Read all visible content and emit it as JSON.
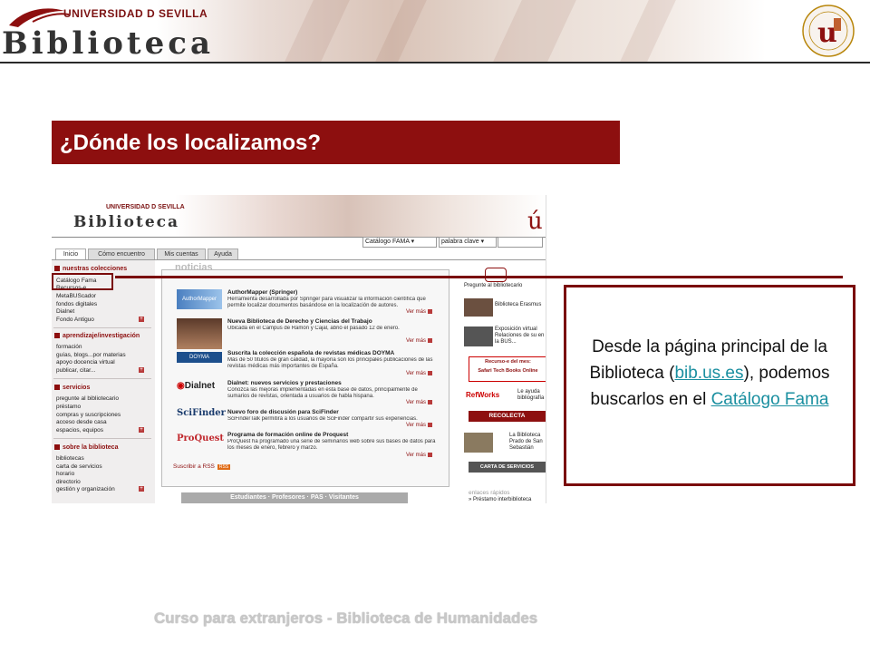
{
  "header": {
    "logo_title": "Biblioteca",
    "logo_university": "UNIVERSIDAD D SEVILLA"
  },
  "slide": {
    "title": "¿Dónde los localizamos?",
    "callout": {
      "text_1": "Desde la página principal de la Biblioteca (",
      "link_1": "bib.us.es",
      "text_2": "), podemos buscarlos en el ",
      "link_2": "Catálogo Fama"
    },
    "footer": "Curso para extranjeros - Biblioteca de Humanidades"
  },
  "screenshot": {
    "logo_title": "Biblioteca",
    "logo_university": "UNIVERSIDAD D SEVILLA",
    "search": {
      "catalog": "Catálogo FAMA",
      "field": "palabra clave"
    },
    "tabs": [
      "Inicio",
      "Cómo encuentro",
      "Mis cuentas",
      "Ayuda"
    ],
    "menu": {
      "collections_title": "nuestras colecciones",
      "collections": [
        "Catálogo Fama",
        "Recursos-e",
        "MetaBUScador",
        "fondos digitales",
        "Dialnet",
        "Fondo Antiguo"
      ],
      "learning_title": "aprendizaje/investigación",
      "learning": [
        "formación",
        "guías, blogs...por materias",
        "apoyo docencia virtual",
        "publicar, citar..."
      ],
      "services_title": "servicios",
      "services": [
        "pregunte al bibliotecario",
        "préstamo",
        "compras y suscripciones",
        "acceso desde casa",
        "espacios, equipos"
      ],
      "about_title": "sobre la biblioteca",
      "about": [
        "bibliotecas",
        "carta de servicios",
        "horario",
        "directorio",
        "gestión y organización"
      ]
    },
    "news_title": "noticias",
    "news": [
      {
        "title": "AuthorMapper (Springer)",
        "text": "Herramienta desarrollada por Springer para visualizar la información científica que permite localizar documentos basándose en la localización de autores."
      },
      {
        "title": "Nueva Biblioteca de Derecho y Ciencias del Trabajo",
        "text": "Ubicada en el Campus de Ramón y Cajal, abrió el pasado 12 de enero."
      },
      {
        "title": "Suscrita la colección española de revistas médicas DOYMA",
        "text": "Más de 50 títulos de gran calidad, la mayoría son los principales publicaciones de las revistas médicas más importantes de España."
      },
      {
        "title": "Dialnet: nuevos servicios y prestaciones",
        "text": "Conozca las mejoras implementadas en esta base de datos, principalmente de sumarios de revistas, orientada a usuarios de habla hispana."
      },
      {
        "title": "Nuevo foro de discusión para SciFinder",
        "text": "SciFinderTalk permitirá a los usuarios de SciFinder compartir sus experiencias."
      },
      {
        "title": "Programa de formación online de Proquest",
        "text": "ProQuest ha programado una serie de seminarios web sobre sus bases de datos para los meses de enero, febrero y marzo."
      }
    ],
    "news_images": [
      "AuthorMapper",
      "",
      "DOYMA",
      "Dialnet",
      "SciFinder",
      "ProQuest"
    ],
    "vermas": "Ver más",
    "rss": "Suscribir a RSS",
    "rss_badge": "RSS",
    "bottom_bar": "Estudiantes · Profesores · PAS · Visitantes",
    "right": {
      "ask": "Pregunte al bibliotecario",
      "erasmus": "Biblioteca Erasmus",
      "exhibit": "Exposición virtual Relaciones de su en la BUS...",
      "recurso": "Recurso-e del mes:",
      "safari": "Safari Tech Books Online",
      "refworks": "RefWorks",
      "refworks_txt": "Le ayuda bibliografía",
      "recolecta": "RECOLECTA",
      "library": "La Biblioteca Prado de San Sebastián",
      "carta": "CARTA DE SERVICIOS",
      "quick": "enlaces rápidos",
      "loan": "» Préstamo interbiblioteca"
    }
  }
}
